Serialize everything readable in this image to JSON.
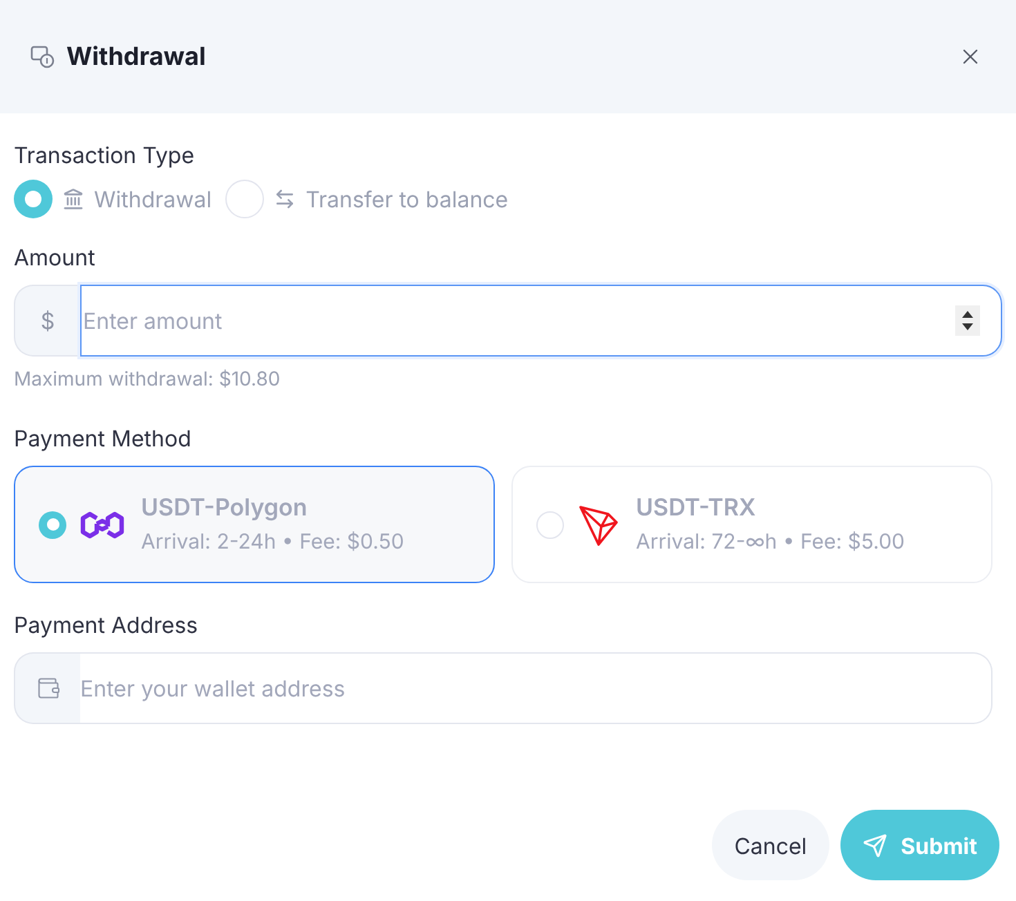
{
  "dialog": {
    "title": "Withdrawal"
  },
  "transaction_type": {
    "label": "Transaction Type",
    "options": [
      {
        "label": "Withdrawal",
        "kind": "bank",
        "selected": true
      },
      {
        "label": "Transfer to balance",
        "kind": "transfer",
        "selected": false
      }
    ]
  },
  "amount": {
    "label": "Amount",
    "prefix": "$",
    "placeholder": "Enter amount",
    "hint": "Maximum withdrawal: $10.80"
  },
  "payment_method": {
    "label": "Payment Method",
    "options": [
      {
        "name": "USDT-Polygon",
        "details": "Arrival: 2-24h • Fee: $0.50",
        "kind": "polygon",
        "selected": true
      },
      {
        "name": "USDT-TRX",
        "details": "Arrival: 72-∞h • Fee: $5.00",
        "kind": "tron",
        "selected": false
      }
    ]
  },
  "payment_address": {
    "label": "Payment Address",
    "placeholder": "Enter your wallet address"
  },
  "buttons": [
    {
      "label": "Cancel",
      "kind": "secondary"
    },
    {
      "label": "Submit",
      "kind": "primary"
    }
  ]
}
